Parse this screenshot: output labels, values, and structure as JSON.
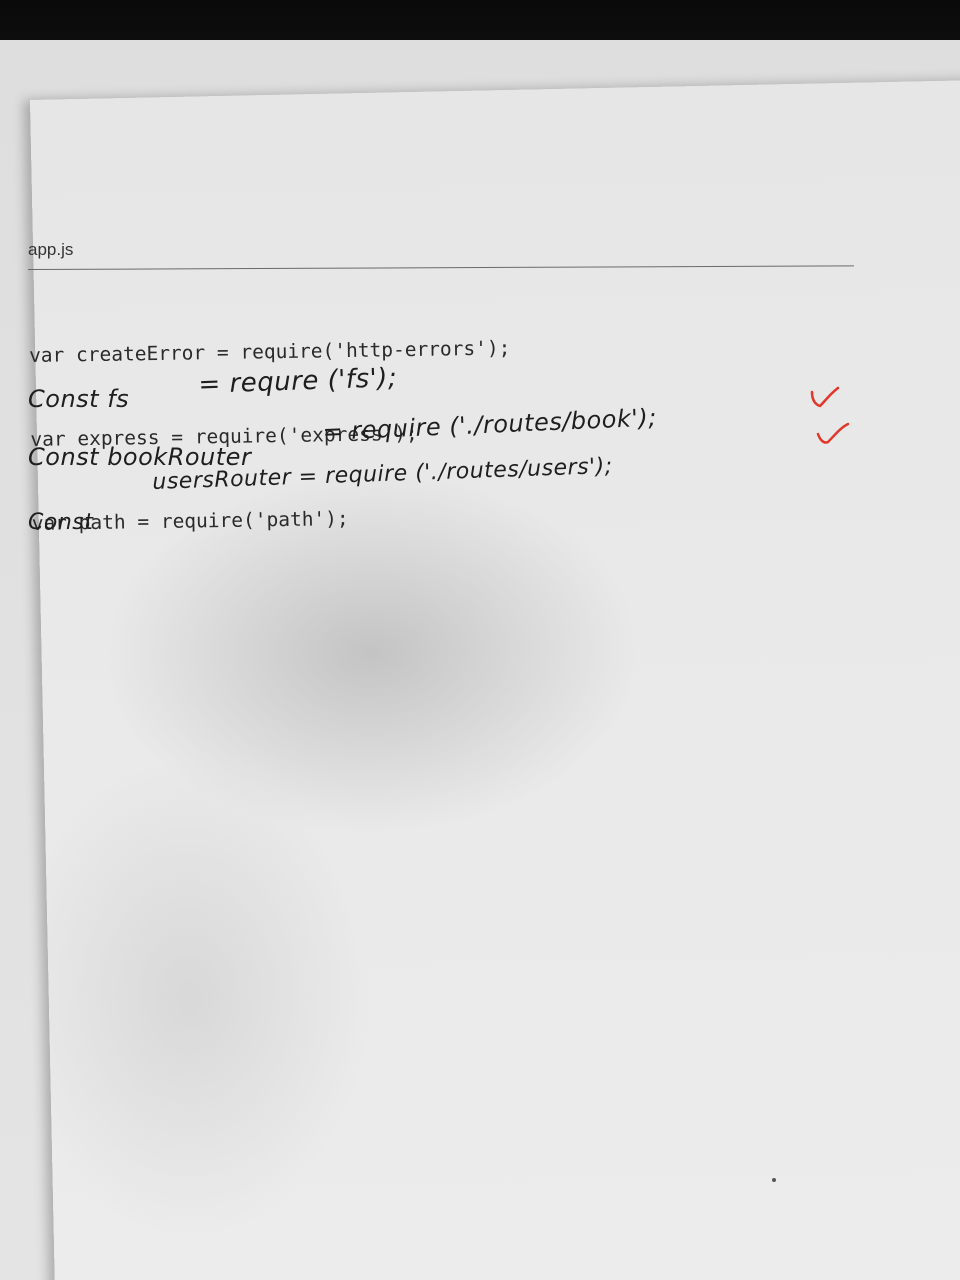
{
  "document": {
    "filename": "app.js",
    "printed_code": [
      "var createError = require('http-errors');",
      "var express = require('express');",
      "var path = require('path');"
    ]
  },
  "handwriting": {
    "line_1": {
      "left": "Const fs",
      "right": "= requre ('fs');"
    },
    "line_2": {
      "left": "Const bookRouter",
      "right": "= require ('./routes/book');"
    },
    "line_3": {
      "left": "Const",
      "right": "usersRouter = require ('./routes/users');"
    }
  },
  "annotations": {
    "check_color": "#e0392b",
    "check_count": 2
  }
}
